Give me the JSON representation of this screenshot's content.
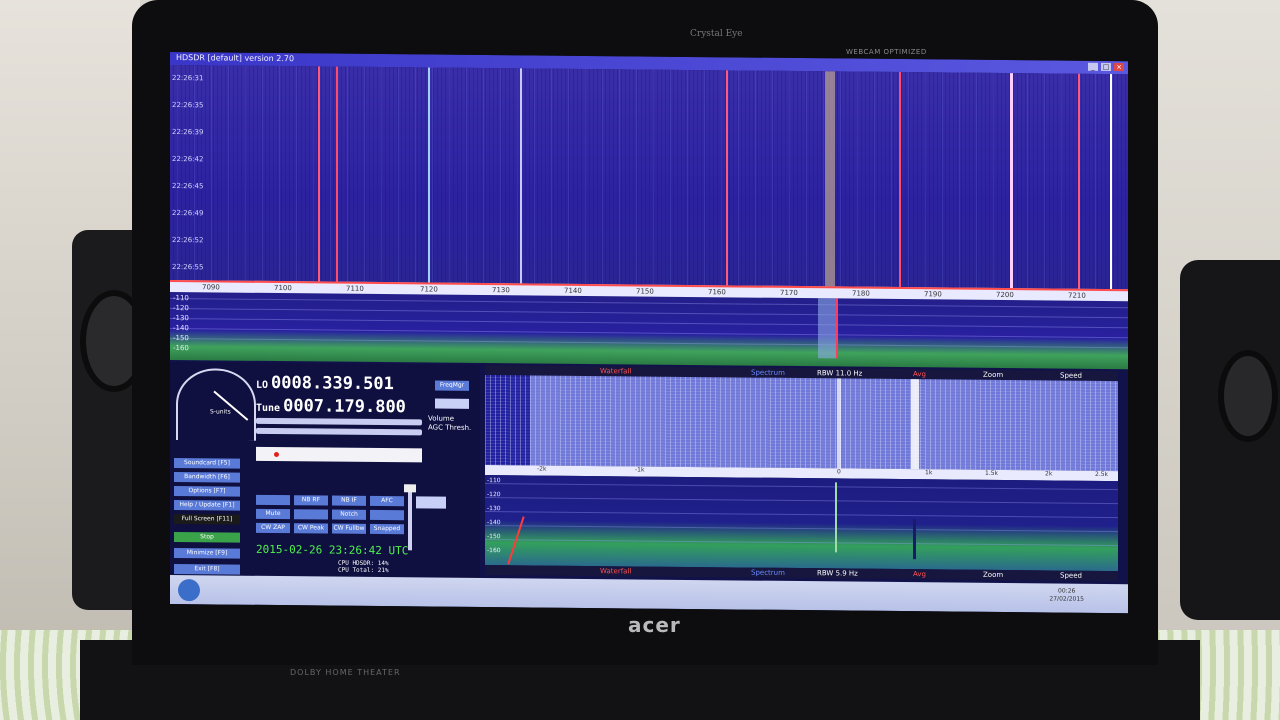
{
  "device": {
    "camera_label": "Crystal Eye",
    "camera_badge": "WEBCAM OPTIMIZED",
    "brand": "acer",
    "audio_label": "DOLBY HOME THEATER"
  },
  "window": {
    "title": "HDSDR [default] version 2.70",
    "btn_min": "_",
    "btn_max": "□",
    "btn_close": "×"
  },
  "waterfall_top": {
    "time_labels": [
      "22:26:31",
      "22:26:35",
      "22:26:39",
      "22:26:42",
      "22:26:45",
      "22:26:49",
      "22:26:52",
      "22:26:55"
    ],
    "freq_labels": [
      "7090",
      "7100",
      "7110",
      "7120",
      "7130",
      "7140",
      "7150",
      "7160",
      "7170",
      "7180",
      "7190",
      "7200",
      "7210"
    ],
    "db_labels": [
      "-110",
      "-120",
      "-130",
      "-140",
      "-150",
      "-160"
    ]
  },
  "controls": {
    "lo_label": "LO",
    "lo_value": "0008.339.501",
    "tune_label": "Tune",
    "tune_value": "0007.179.800",
    "freqmgr": "FreqMgr",
    "volume_label": "Volume",
    "agc_label": "AGC Thresh.",
    "smeter_label": "S-units",
    "side_buttons": [
      "Soundcard [F5]",
      "Bandwidth [F6]",
      "Options [F7]",
      "Help / Update [F1]",
      "Full Screen [F11]",
      "Stop",
      "Minimize [F9]",
      "Exit [F8]"
    ],
    "mode_buttons": [
      "",
      "NB RF",
      "NB IF",
      "AFC",
      "Mute",
      "",
      "Notch",
      "",
      "CW ZAP",
      "CW Peak",
      "CW Fullbw",
      "Snapped"
    ],
    "datetime": "2015-02-26  23:26:42 UTC",
    "cpu_hdsdr": "CPU HDSDR: 14%",
    "cpu_total": "CPU Total: 21%"
  },
  "zoom_panel": {
    "top_bar": {
      "waterfall": "Waterfall",
      "spectrum": "Spectrum",
      "rbw": "RBW 11.0 Hz",
      "avg": "Avg",
      "zoom": "Zoom",
      "speed": "Speed"
    },
    "scale_labels": [
      "-2k",
      "-1k",
      "0",
      "1k",
      "1.5k",
      "2k",
      "2.5k"
    ],
    "db_labels": [
      "-110",
      "-120",
      "-130",
      "-140",
      "-150",
      "-160"
    ],
    "bottom_bar": {
      "waterfall": "Waterfall",
      "spectrum": "Spectrum",
      "rbw": "RBW 5.9 Hz",
      "avg": "Avg",
      "zoom": "Zoom",
      "speed": "Speed"
    }
  },
  "taskbar": {
    "time": "00:26",
    "date": "27/02/2015"
  }
}
